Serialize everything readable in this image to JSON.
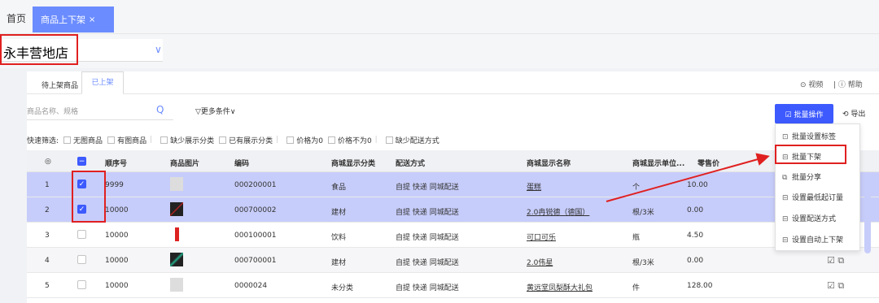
{
  "tabs": {
    "home": "首页",
    "active": "商品上下架",
    "close": "×"
  },
  "store": {
    "name": "永丰营地店",
    "chevron": "∨"
  },
  "subtabs": {
    "pending": "待上架商品",
    "listed": "已上架"
  },
  "help": {
    "video": "⊙ 视频",
    "help": "| ⓘ 帮助"
  },
  "search": {
    "placeholder": "商品名称、规格",
    "icon": "search-icon",
    "more": "▽更多条件∨"
  },
  "toolbar": {
    "batch": "☑ 批量操作",
    "export": "⟲ 导出"
  },
  "filters": {
    "label": "快速筛选:",
    "items": [
      "无图商品",
      "有图商品",
      "缺少展示分类",
      "已有展示分类",
      "价格为0",
      "价格不为0",
      "缺少配送方式"
    ]
  },
  "table": {
    "headers": [
      "◎",
      "顺序号",
      "商品图片",
      "编码",
      "商城显示分类",
      "配送方式",
      "商城显示名称",
      "商城显示单位...",
      "零售价"
    ],
    "rows": [
      {
        "idx": "1",
        "order": "9999",
        "code": "000200001",
        "cat": "食品",
        "ship": "自提 快递 同城配送",
        "name": "蛋糕",
        "unit": "个",
        "price": "10.00"
      },
      {
        "idx": "2",
        "order": "10000",
        "code": "000700002",
        "cat": "建材",
        "ship": "自提 快递 同城配送",
        "name": "2.0冉锐德（德国）",
        "unit": "根/3米",
        "price": "0.00"
      },
      {
        "idx": "3",
        "order": "10000",
        "code": "000100001",
        "cat": "饮料",
        "ship": "自提 快递 同城配送",
        "name": "可口可乐",
        "unit": "瓶",
        "price": "4.50"
      },
      {
        "idx": "4",
        "order": "10000",
        "code": "000700001",
        "cat": "建材",
        "ship": "自提 快递 同城配送",
        "name": "2.0伟星",
        "unit": "根/3米",
        "price": "0.00"
      },
      {
        "idx": "5",
        "order": "10000",
        "code": "0000024",
        "cat": "未分类",
        "ship": "自提 快递 同城配送",
        "name": "黄远堂凤梨酥大礼包",
        "unit": "件",
        "price": "128.00"
      }
    ],
    "row_icons": "☑ ⧉"
  },
  "menu": {
    "items": [
      "批量设置标签",
      "批量下架",
      "批量分享",
      "设置最低起订量",
      "设置配送方式",
      "设置自动上下架"
    ]
  },
  "colors": {
    "accent": "#3d5afe",
    "tab": "#6b8cff",
    "selected_row": "#c7cdfa",
    "highlight": "#e02020"
  }
}
